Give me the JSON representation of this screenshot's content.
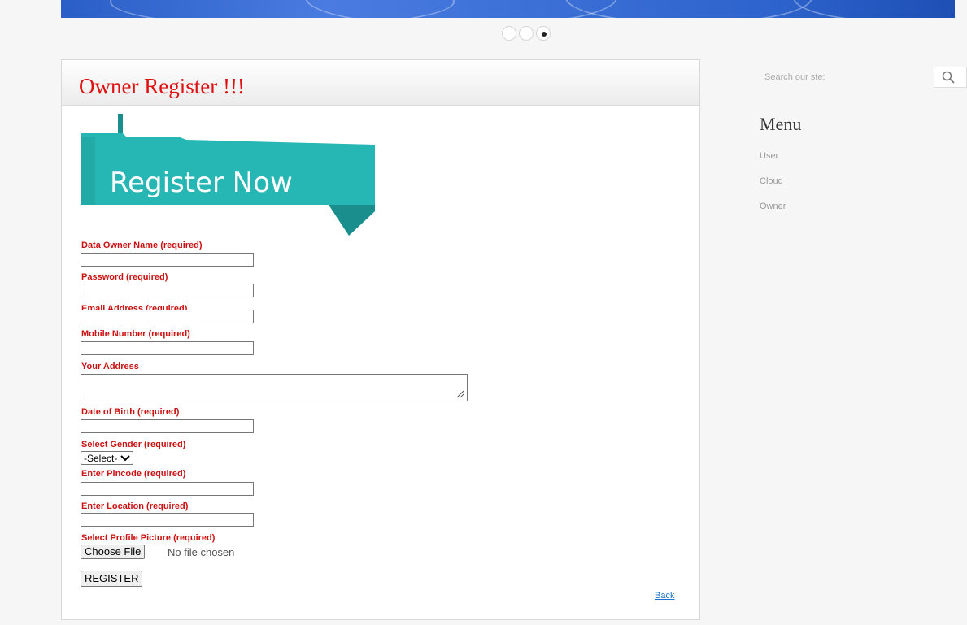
{
  "carousel": {
    "slide_count": 3,
    "active_slide": 3
  },
  "panel": {
    "title": "Owner Register !!!",
    "ribbon_text": "Register Now"
  },
  "form": {
    "owner_name_label": "Data Owner Name (required)",
    "password_label": "Password (required)",
    "email_label": "Email Address (required)",
    "mobile_label": "Mobile Number (required)",
    "address_label": "Your Address",
    "dob_label": "Date of Birth (required)",
    "gender_label": "Select Gender (required)",
    "gender_selected": "-Select-",
    "pincode_label": "Enter Pincode (required)",
    "location_label": "Enter Location (required)",
    "picture_label": "Select Profile Picture (required)",
    "choose_file_label": "Choose File",
    "file_status": "No file chosen",
    "register_label": "REGISTER",
    "back_label": "Back"
  },
  "sidebar": {
    "search_label": "Search our ste:",
    "menu_title": "Menu",
    "items": [
      "User",
      "Cloud",
      "Owner"
    ]
  },
  "colors": {
    "title_red": "#e01010",
    "label_red": "#cc1111",
    "ribbon_teal": "#26b6b3",
    "banner_blue": "#3b6fd6"
  }
}
